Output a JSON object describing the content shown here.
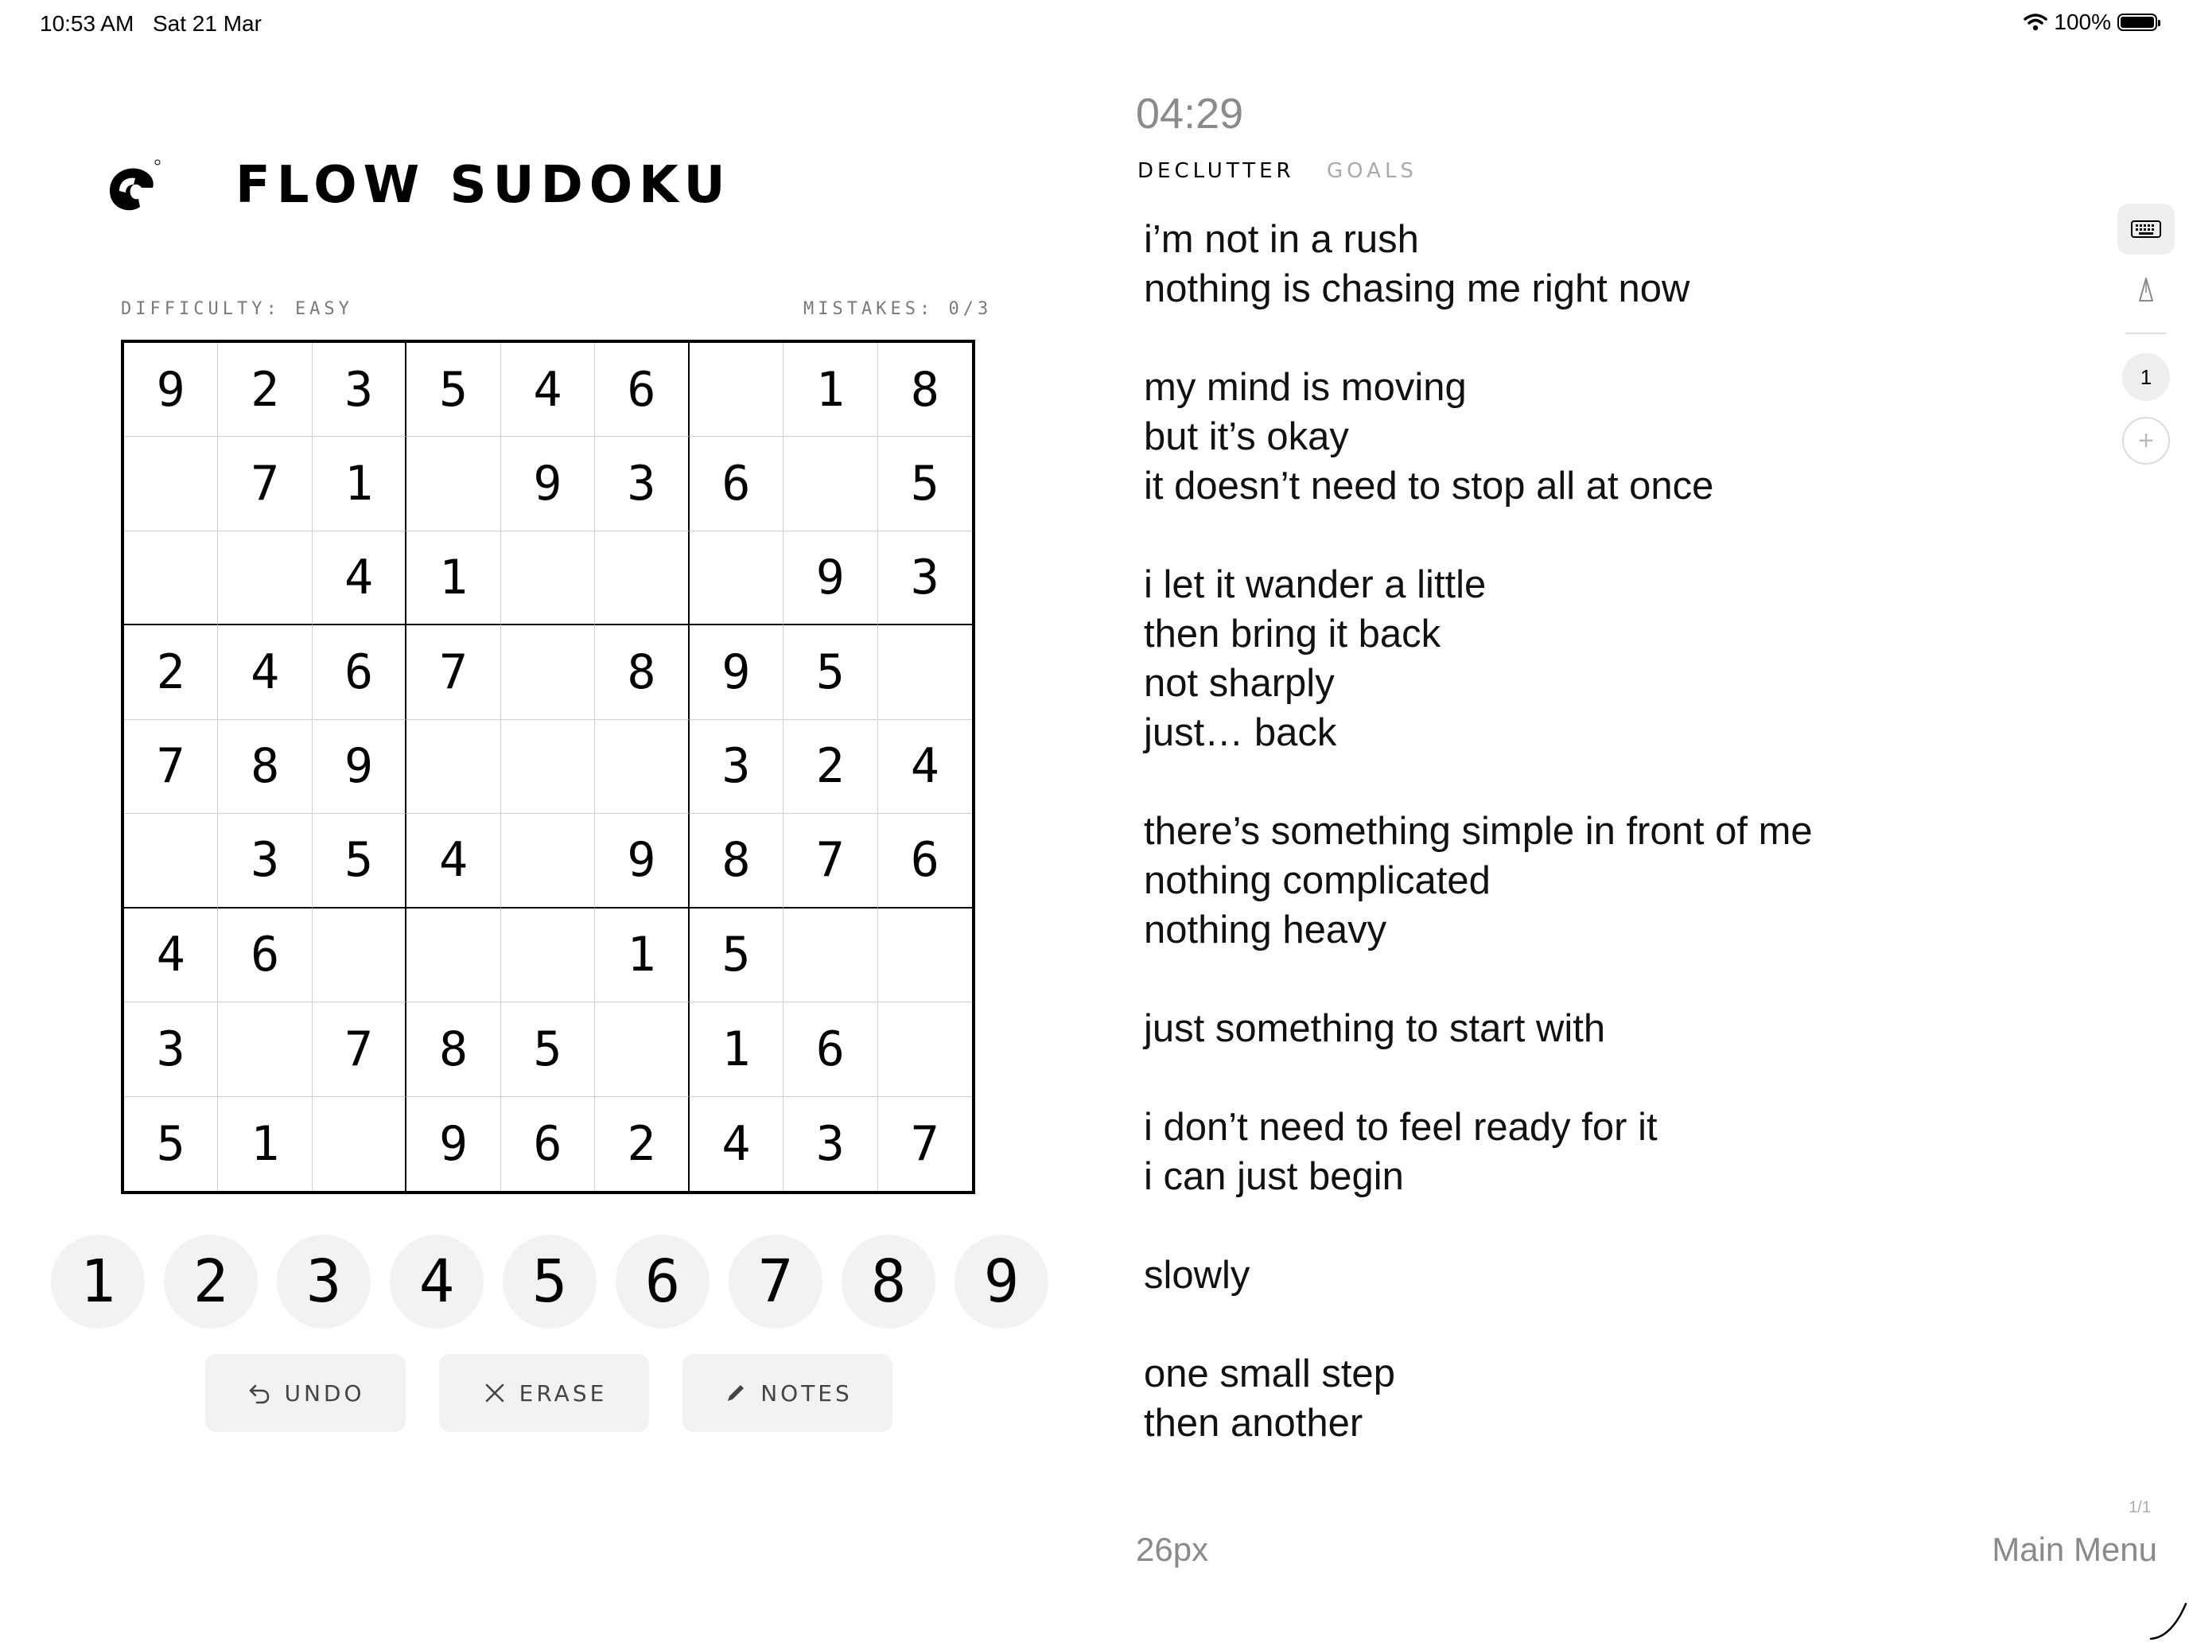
{
  "status_bar": {
    "time": "10:53 AM",
    "date": "Sat 21 Mar",
    "battery": "100%",
    "battery_level": 1.0
  },
  "app": {
    "title": "FLOW SUDOKU",
    "difficulty": "DIFFICULTY: EASY",
    "mistakes": "MISTAKES: 0/3"
  },
  "grid": [
    [
      "9",
      "2",
      "3",
      "5",
      "4",
      "6",
      "",
      "1",
      "8"
    ],
    [
      "",
      "7",
      "1",
      "",
      "9",
      "3",
      "6",
      "",
      "5"
    ],
    [
      "",
      "",
      "4",
      "1",
      "",
      "",
      "",
      "9",
      "3"
    ],
    [
      "2",
      "4",
      "6",
      "7",
      "",
      "8",
      "9",
      "5",
      ""
    ],
    [
      "7",
      "8",
      "9",
      "",
      "",
      "",
      "3",
      "2",
      "4"
    ],
    [
      "",
      "3",
      "5",
      "4",
      "",
      "9",
      "8",
      "7",
      "6"
    ],
    [
      "4",
      "6",
      "",
      "",
      "",
      "1",
      "5",
      "",
      ""
    ],
    [
      "3",
      "",
      "7",
      "8",
      "5",
      "",
      "1",
      "6",
      ""
    ],
    [
      "5",
      "1",
      "",
      "9",
      "6",
      "2",
      "4",
      "3",
      "7"
    ]
  ],
  "numpad": [
    "1",
    "2",
    "3",
    "4",
    "5",
    "6",
    "7",
    "8",
    "9"
  ],
  "actions": {
    "undo": "UNDO",
    "erase": "ERASE",
    "notes": "NOTES"
  },
  "journal": {
    "timer": "04:29",
    "tabs": [
      "DECLUTTER",
      "GOALS"
    ],
    "lines": [
      "i’m not in a rush",
      "nothing is chasing me right now",
      "",
      "my mind is moving",
      "but it’s okay",
      "it doesn’t need to stop all at once",
      "",
      "i let it wander a little",
      "then bring it back",
      "not sharply",
      "just… back",
      "",
      "there’s something simple in front of me",
      "nothing complicated",
      "nothing heavy",
      "",
      "just something to start with",
      "",
      "i don’t need to feel ready for it",
      "i can just begin",
      "",
      "slowly",
      "",
      "one small step",
      "then another"
    ],
    "font_size": "26px",
    "main_menu": "Main Menu",
    "page_indicator": "1/1",
    "page_number": "1",
    "add_page": "+"
  },
  "icons": {
    "logo": "flow-logo",
    "undo": "undo-arrow-icon",
    "erase": "close-icon",
    "notes": "pencil-icon",
    "keyboard": "keyboard-icon",
    "pen": "pen-icon",
    "wifi": "wifi-icon",
    "battery": "battery-icon"
  }
}
